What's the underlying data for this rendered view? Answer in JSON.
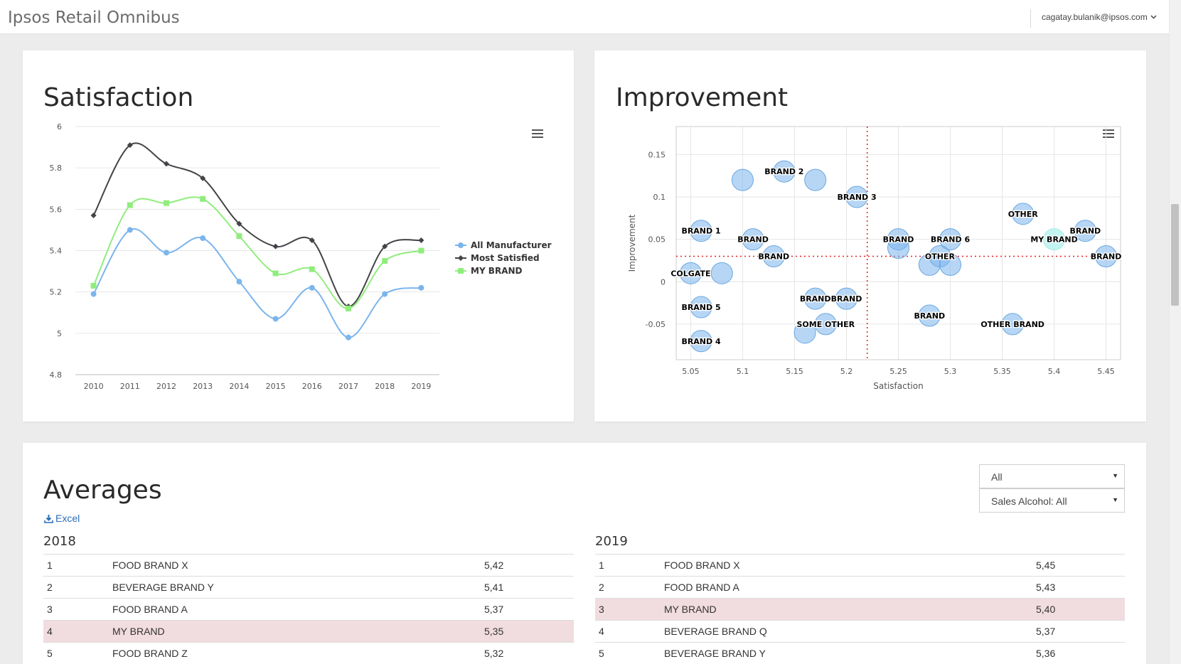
{
  "app": {
    "title": "Ipsos Retail Omnibus",
    "user": "cagatay.bulanik@ipsos.com"
  },
  "satisfaction": {
    "title": "Satisfaction",
    "chart_data": {
      "type": "line",
      "categories": [
        "2010",
        "2011",
        "2012",
        "2013",
        "2014",
        "2015",
        "2016",
        "2017",
        "2018",
        "2019"
      ],
      "ylim": [
        4.8,
        6
      ],
      "yticks": [
        "4.8",
        "5",
        "5.2",
        "5.4",
        "5.6",
        "5.8",
        "6"
      ],
      "grid": true,
      "legend": "right",
      "series": [
        {
          "name": "All Manufacturer",
          "color": "#7cb5ec",
          "marker": "circle",
          "values": [
            5.19,
            5.5,
            5.39,
            5.46,
            5.25,
            5.07,
            5.22,
            4.98,
            5.19,
            5.22
          ]
        },
        {
          "name": "Most Satisfied",
          "color": "#434348",
          "marker": "diamond",
          "values": [
            5.57,
            5.91,
            5.82,
            5.75,
            5.53,
            5.42,
            5.45,
            5.13,
            5.42,
            5.45
          ]
        },
        {
          "name": "MY BRAND",
          "color": "#90ed7d",
          "marker": "square",
          "values": [
            5.23,
            5.62,
            5.63,
            5.65,
            5.47,
            5.29,
            5.31,
            5.12,
            5.35,
            5.4
          ]
        }
      ]
    }
  },
  "improvement": {
    "title": "Improvement",
    "chart_data": {
      "type": "scatter",
      "xlabel": "Satisfaction",
      "ylabel": "Improvement",
      "xlim": [
        5.036,
        5.464
      ],
      "ylim": [
        -0.092,
        0.183
      ],
      "xticks": [
        "5.05",
        "5.1",
        "5.15",
        "5.2",
        "5.25",
        "5.3",
        "5.35",
        "5.4",
        "5.45"
      ],
      "yticks": [
        "-0.05",
        "0",
        "0.05",
        "0.1",
        "0.15"
      ],
      "reference_x": 5.22,
      "reference_y": 0.03,
      "points": [
        {
          "x": 5.14,
          "y": 0.13,
          "label": "BRAND 2"
        },
        {
          "x": 5.1,
          "y": 0.12,
          "label": ""
        },
        {
          "x": 5.17,
          "y": 0.12,
          "label": ""
        },
        {
          "x": 5.21,
          "y": 0.1,
          "label": "BRAND 3"
        },
        {
          "x": 5.06,
          "y": 0.06,
          "label": "BRAND 1"
        },
        {
          "x": 5.11,
          "y": 0.05,
          "label": "BRAND"
        },
        {
          "x": 5.13,
          "y": 0.03,
          "label": "BRAND"
        },
        {
          "x": 5.05,
          "y": 0.01,
          "label": "COLGATE"
        },
        {
          "x": 5.08,
          "y": 0.01,
          "label": ""
        },
        {
          "x": 5.06,
          "y": -0.03,
          "label": "BRAND 5"
        },
        {
          "x": 5.06,
          "y": -0.07,
          "label": "BRAND 4"
        },
        {
          "x": 5.17,
          "y": -0.02,
          "label": "BRAND"
        },
        {
          "x": 5.2,
          "y": -0.02,
          "label": "BRAND"
        },
        {
          "x": 5.18,
          "y": -0.05,
          "label": "SOME OTHER"
        },
        {
          "x": 5.16,
          "y": -0.06,
          "label": ""
        },
        {
          "x": 5.25,
          "y": 0.05,
          "label": "BRAND"
        },
        {
          "x": 5.25,
          "y": 0.04,
          "label": ""
        },
        {
          "x": 5.3,
          "y": 0.05,
          "label": "BRAND 6"
        },
        {
          "x": 5.29,
          "y": 0.03,
          "label": "OTHER"
        },
        {
          "x": 5.28,
          "y": 0.02,
          "label": ""
        },
        {
          "x": 5.3,
          "y": 0.02,
          "label": ""
        },
        {
          "x": 5.28,
          "y": -0.04,
          "label": "BRAND"
        },
        {
          "x": 5.37,
          "y": 0.08,
          "label": "OTHER"
        },
        {
          "x": 5.4,
          "y": 0.05,
          "label": "MY BRAND",
          "highlight": true
        },
        {
          "x": 5.43,
          "y": 0.06,
          "label": "BRAND"
        },
        {
          "x": 5.45,
          "y": 0.03,
          "label": "BRAND"
        },
        {
          "x": 5.36,
          "y": -0.05,
          "label": "OTHER BRAND"
        }
      ]
    }
  },
  "averages": {
    "title": "Averages",
    "excel_label": "Excel",
    "filter1": "All",
    "filter2": "Sales Alcohol: All",
    "tables": [
      {
        "year": "2018",
        "rows": [
          {
            "rank": "1",
            "name": "FOOD BRAND X",
            "value": "5,42"
          },
          {
            "rank": "2",
            "name": "BEVERAGE BRAND Y",
            "value": "5,41"
          },
          {
            "rank": "3",
            "name": "FOOD BRAND A",
            "value": "5,37"
          },
          {
            "rank": "4",
            "name": "MY BRAND",
            "value": "5,35"
          },
          {
            "rank": "5",
            "name": "FOOD BRAND Z",
            "value": "5,32"
          }
        ]
      },
      {
        "year": "2019",
        "rows": [
          {
            "rank": "1",
            "name": "FOOD BRAND X",
            "value": "5,45"
          },
          {
            "rank": "2",
            "name": "FOOD BRAND A",
            "value": "5,43"
          },
          {
            "rank": "3",
            "name": "MY BRAND",
            "value": "5,40"
          },
          {
            "rank": "4",
            "name": "BEVERAGE BRAND Q",
            "value": "5,37"
          },
          {
            "rank": "5",
            "name": "BEVERAGE BRAND Y",
            "value": "5,36"
          }
        ]
      }
    ]
  }
}
